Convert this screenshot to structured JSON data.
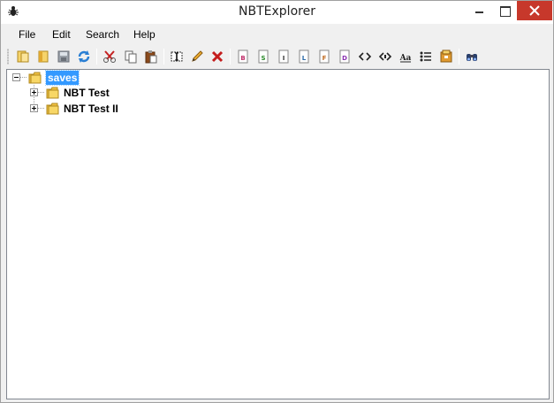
{
  "window": {
    "title": "NBTExplorer"
  },
  "menu": {
    "items": [
      "File",
      "Edit",
      "Search",
      "Help"
    ]
  },
  "toolbar": {
    "icons": [
      "open-icon",
      "open-folder-icon",
      "save-icon",
      "refresh-icon",
      "cut-icon",
      "copy-icon",
      "paste-icon",
      "rename-icon",
      "edit-value-icon",
      "delete-icon",
      "add-byte-icon",
      "add-short-icon",
      "add-int-icon",
      "add-long-icon",
      "add-float-icon",
      "add-double-icon",
      "add-byte-array-icon",
      "add-int-array-icon",
      "add-string-icon",
      "add-list-icon",
      "add-compound-icon",
      "find-icon"
    ],
    "tag_letters": {
      "byte": "B",
      "short": "S",
      "int": "I",
      "long": "L",
      "float": "F",
      "double": "D"
    },
    "string_glyph": "Aa"
  },
  "tree": {
    "root": {
      "label": "saves",
      "expanded": true,
      "selected": true
    },
    "children": [
      {
        "label": "NBT Test",
        "expanded": false
      },
      {
        "label": "NBT Test II",
        "expanded": false
      }
    ]
  },
  "colors": {
    "selection": "#3399ff",
    "close_button": "#c7382b",
    "folder": "#f0c040"
  }
}
